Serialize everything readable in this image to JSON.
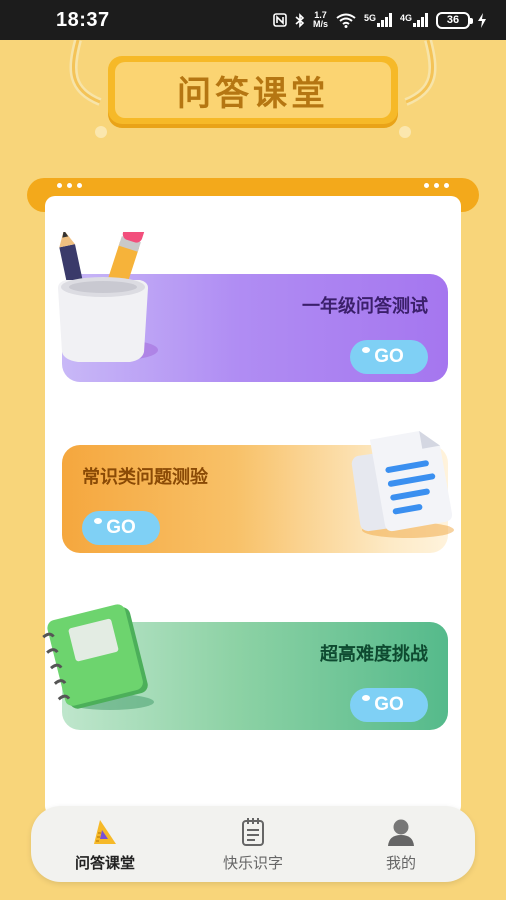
{
  "status_bar": {
    "time": "18:37",
    "speed_value": "1.7",
    "speed_unit": "M/s",
    "net1": "5G",
    "net2": "4G",
    "battery": "36"
  },
  "header": {
    "title": "问答课堂"
  },
  "cards": [
    {
      "title": "一年级问答测试",
      "button": "GO",
      "illustration": "pencil-cup-icon"
    },
    {
      "title": "常识类问题测验",
      "button": "GO",
      "illustration": "documents-icon"
    },
    {
      "title": "超高难度挑战",
      "button": "GO",
      "illustration": "notebook-icon"
    }
  ],
  "tabs": [
    {
      "label": "问答课堂",
      "icon": "ruler-triangle-icon",
      "active": true
    },
    {
      "label": "快乐识字",
      "icon": "notepad-icon",
      "active": false
    },
    {
      "label": "我的",
      "icon": "user-icon",
      "active": false
    }
  ],
  "colors": {
    "background": "#f8d57a",
    "accent": "#f3a91b",
    "go_button": "#7fd0f5"
  }
}
